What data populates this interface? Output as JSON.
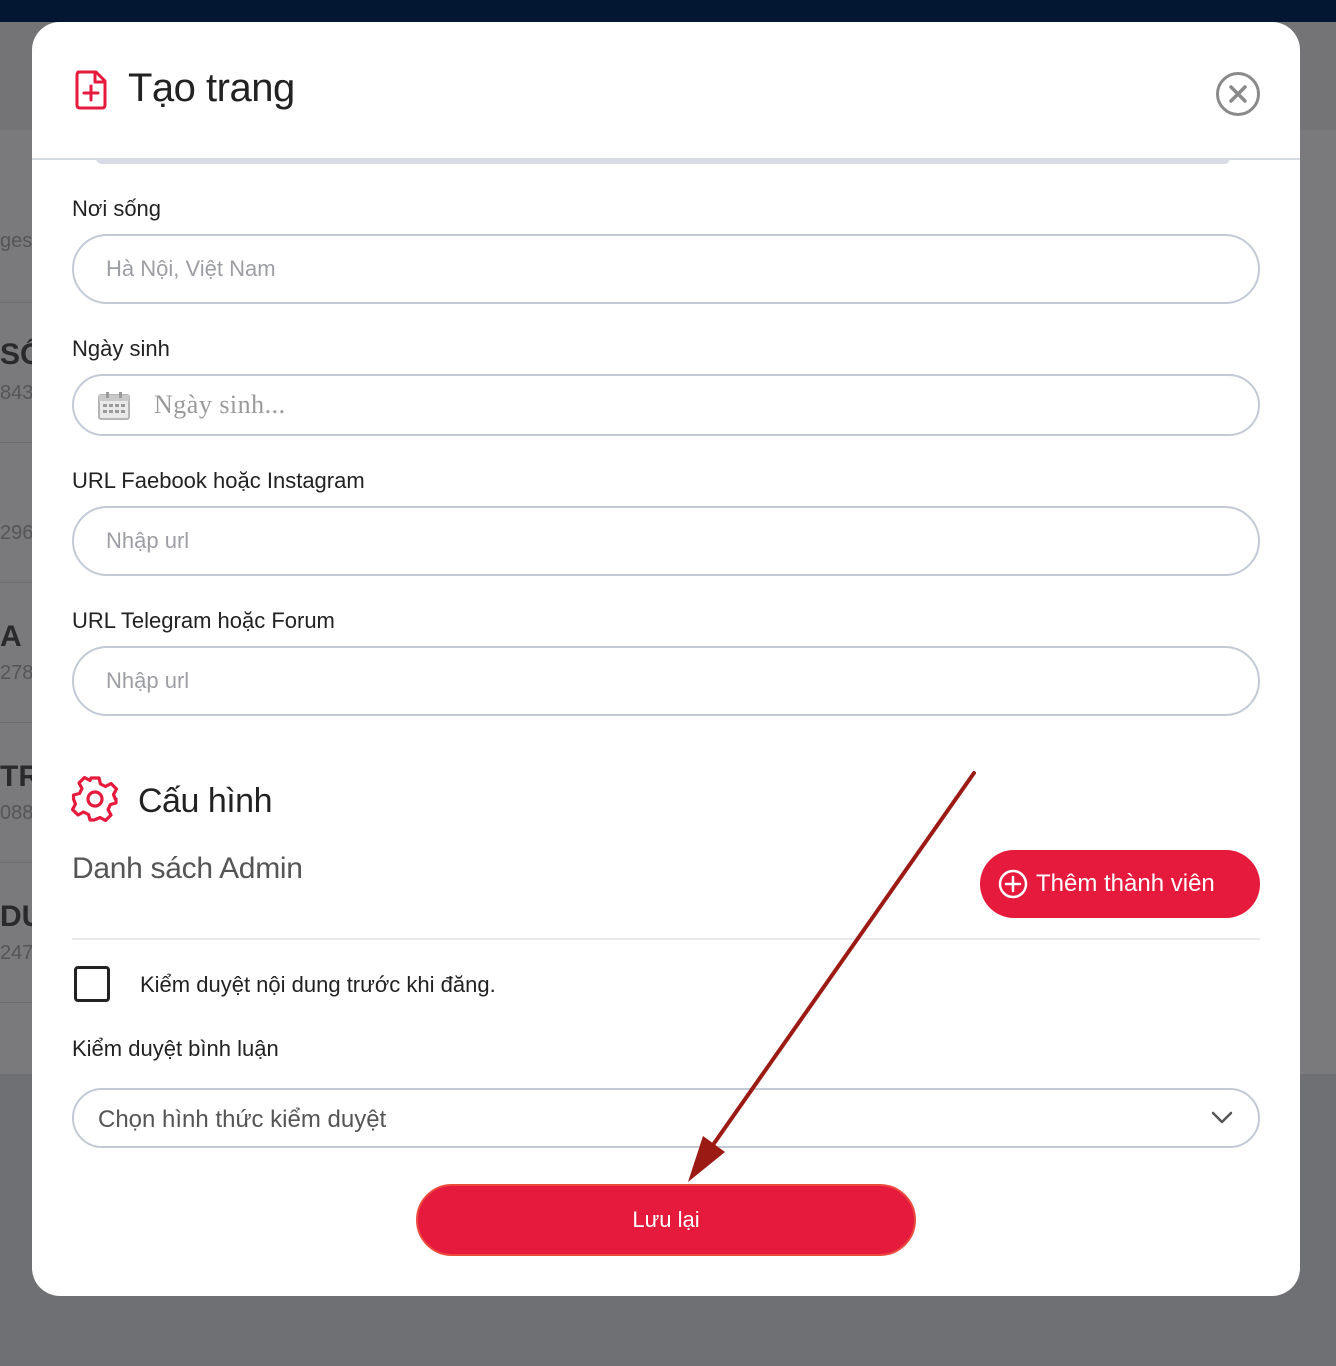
{
  "background": {
    "texts": [
      {
        "text": "ges",
        "size": "sub"
      },
      {
        "text": "SỐ",
        "size": "big"
      },
      {
        "text": "843",
        "size": "sub"
      },
      {
        "text": "296",
        "size": "sub"
      },
      {
        "text": "A",
        "size": "big"
      },
      {
        "text": "278",
        "size": "sub"
      },
      {
        "text": "TR",
        "size": "big"
      },
      {
        "text": "088",
        "size": "sub"
      },
      {
        "text": "DU",
        "size": "big"
      },
      {
        "text": "247",
        "size": "sub"
      }
    ]
  },
  "modal": {
    "title": "Tạo trang",
    "header_icon": "file-plus-icon",
    "close_icon": "close-circle-icon"
  },
  "form": {
    "residence": {
      "label": "Nơi sống",
      "placeholder": "Hà Nội, Việt Nam",
      "value": ""
    },
    "birthday": {
      "label": "Ngày sinh",
      "placeholder": "Ngày sinh...",
      "icon": "calendar-icon"
    },
    "facebook": {
      "label": "URL Faebook hoặc Instagram",
      "placeholder": "Nhập url",
      "value": ""
    },
    "telegram": {
      "label": "URL Telegram hoặc Forum",
      "placeholder": "Nhập url",
      "value": ""
    }
  },
  "config": {
    "title": "Cấu hình",
    "icon": "gear-icon",
    "admin_list_title": "Danh sách Admin",
    "add_member_label": "Thêm thành viên",
    "add_member_icon": "plus-circle-icon",
    "moderation_checkbox_label": "Kiểm duyệt nội dung trước khi đăng.",
    "moderation_checked": false,
    "comment_moderation": {
      "label": "Kiểm duyệt bình luận",
      "selected": "Chọn hình thức kiểm duyệt",
      "icon": "chevron-down-icon"
    }
  },
  "actions": {
    "save_label": "Lưu lại"
  },
  "colors": {
    "accent": "#e51a3c",
    "topbar": "#031733",
    "annotation_arrow": "#9c1a14",
    "input_border": "#c3cad6"
  }
}
